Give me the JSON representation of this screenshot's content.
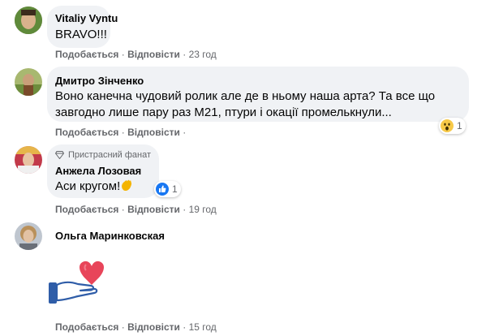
{
  "comments": [
    {
      "author": "Vitaliy Vyntu",
      "text": "BRAVO!!!",
      "like": "Подобається",
      "reply": "Відповісти",
      "time": "23 год"
    },
    {
      "author": "Дмитро Зінченко",
      "text_line1": "Воно канечна чудовий ролик але де в ньому наша арта? Та все що",
      "text_line2": "завгодно лише пару раз М21, птури і окації промелькнули...",
      "like": "Подобається",
      "reply": "Відповісти",
      "time": "",
      "reaction": {
        "icon": "wow-emoji-icon",
        "count": "1"
      }
    },
    {
      "badge": "Пристрасний фанат",
      "badge_icon": "diamond-icon",
      "author": "Анжела Лозовая",
      "text": "Аси кругом!",
      "emoji": "clapping-hands-icon",
      "like": "Подобається",
      "reply": "Відповісти",
      "time": "19 год",
      "reaction": {
        "icon": "like-icon",
        "count": "1"
      }
    },
    {
      "author": "Ольга Маринковская",
      "sticker": "hand-holding-heart-sticker",
      "like": "Подобається",
      "reply": "Відповісти",
      "time": "15 год"
    }
  ],
  "separator": " · ",
  "colors": {
    "bubble": "#f0f2f5",
    "meta": "#65676b",
    "like_blue": "#1877f2",
    "heart": "#e0245e"
  }
}
